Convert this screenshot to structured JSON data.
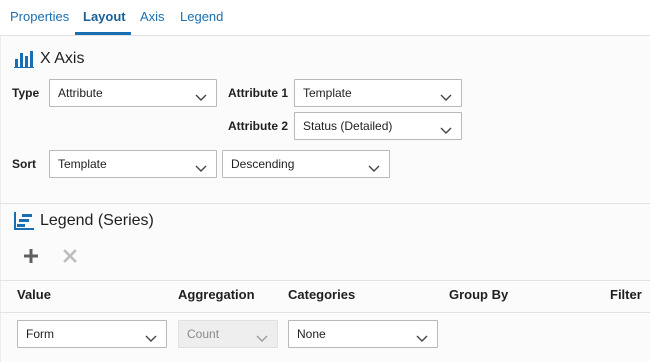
{
  "tabs": [
    {
      "label": "Properties",
      "active": false
    },
    {
      "label": "Layout",
      "active": true
    },
    {
      "label": "Axis",
      "active": false
    },
    {
      "label": "Legend",
      "active": false
    }
  ],
  "x_axis": {
    "title": "X Axis",
    "icon": "bar-chart-icon",
    "type_label": "Type",
    "type_value": "Attribute",
    "attr1_label": "Attribute 1",
    "attr1_value": "Template",
    "attr2_label": "Attribute 2",
    "attr2_value": "Status (Detailed)",
    "sort_label": "Sort",
    "sort_value": "Template",
    "sort_order_value": "Descending"
  },
  "legend": {
    "title": "Legend (Series)",
    "icon": "legend-series-icon",
    "add_icon": "plus-icon",
    "remove_icon": "close-icon",
    "columns": [
      "Value",
      "Aggregation",
      "Categories",
      "Group By",
      "Filter"
    ],
    "row": {
      "value": "Form",
      "aggregation": "Count",
      "categories": "None"
    }
  },
  "colors": {
    "accent": "#1a6fb3",
    "border": "#b9b9b9",
    "disabled_bg": "#eeeeee"
  }
}
